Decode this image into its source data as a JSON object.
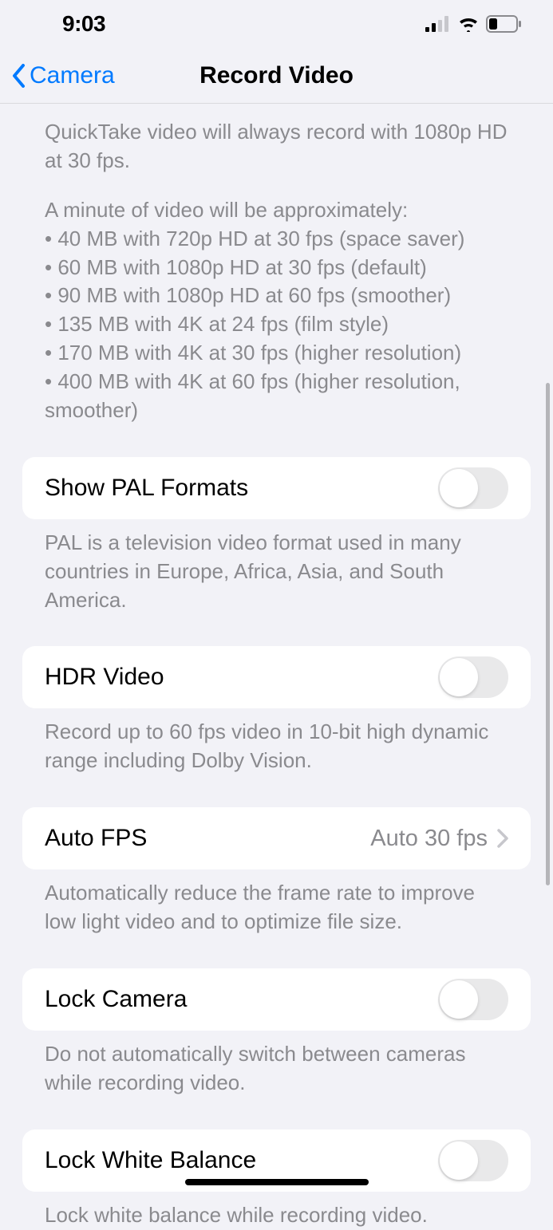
{
  "status": {
    "time": "9:03"
  },
  "nav": {
    "back_label": "Camera",
    "title": "Record Video"
  },
  "info": {
    "quicktake": "QuickTake video will always record with 1080p HD at 30 fps.",
    "minute_intro": "A minute of video will be approximately:",
    "lines": [
      "• 40 MB with 720p HD at 30 fps (space saver)",
      "• 60 MB with 1080p HD at 30 fps (default)",
      "• 90 MB with 1080p HD at 60 fps (smoother)",
      "• 135 MB with 4K at 24 fps (film style)",
      "• 170 MB with 4K at 30 fps (higher resolution)",
      "• 400 MB with 4K at 60 fps (higher resolution, smoother)"
    ]
  },
  "pal": {
    "label": "Show PAL Formats",
    "footer": "PAL is a television video format used in many countries in Europe, Africa, Asia, and South America."
  },
  "hdr": {
    "label": "HDR Video",
    "footer": "Record up to 60 fps video in 10-bit high dynamic range including Dolby Vision."
  },
  "autofps": {
    "label": "Auto FPS",
    "value": "Auto 30 fps",
    "footer": "Automatically reduce the frame rate to improve low light video and to optimize file size."
  },
  "lockcamera": {
    "label": "Lock Camera",
    "footer": "Do not automatically switch between cameras while recording video."
  },
  "lockwb": {
    "label": "Lock White Balance",
    "footer": "Lock white balance while recording video."
  }
}
